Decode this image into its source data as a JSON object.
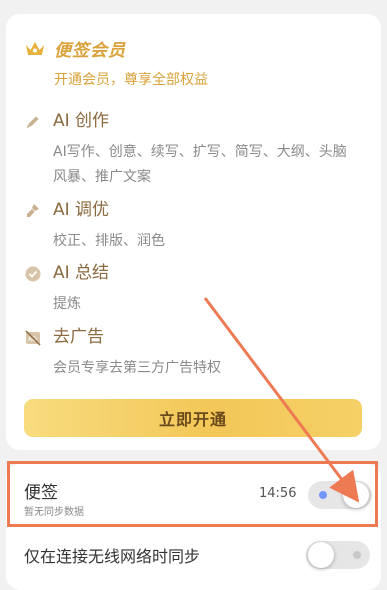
{
  "member": {
    "title": "便签会员",
    "subtitle": "开通会员，尊享全部权益",
    "crown_icon": "crown-icon",
    "accent_color": "#d9a23a",
    "features": [
      {
        "icon": "pen-icon",
        "title": "AI 创作",
        "desc": "AI写作、创意、续写、扩写、简写、大纲、头脑风暴、推广文案"
      },
      {
        "icon": "brush-icon",
        "title": "AI 调优",
        "desc": "校正、排版、润色"
      },
      {
        "icon": "check-circle-icon",
        "title": "AI 总结",
        "desc": "提炼"
      },
      {
        "icon": "no-ads-icon",
        "title": "去广告",
        "desc": "会员专享去第三方广告特权"
      }
    ],
    "button_label": "立即开通"
  },
  "sync": {
    "note": {
      "title": "便签",
      "status": "暂无同步数据",
      "time": "14:56",
      "toggle_on": true
    },
    "wifi": {
      "label": "仅在连接无线网络时同步",
      "toggle_on": false
    }
  },
  "annotation": {
    "color": "#ee7a54"
  }
}
